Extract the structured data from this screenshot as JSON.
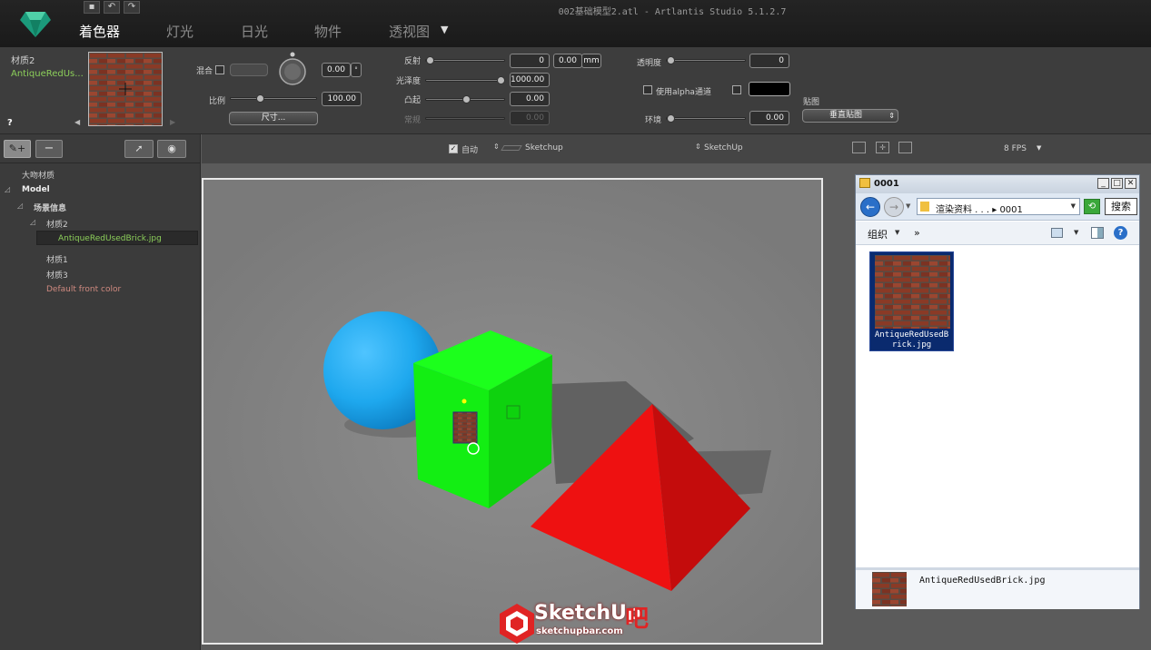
{
  "window": {
    "title": "002基础模型2.atl - Artlantis Studio 5.1.2.7",
    "tabs": [
      "着色器",
      "灯光",
      "日光",
      "物件",
      "透视图"
    ],
    "active_tab": 0
  },
  "material": {
    "name": "材质2",
    "texture_name": "AntiqueRedUs...",
    "help": "?"
  },
  "params": {
    "blend_label": "混合",
    "blend_value": "0.00",
    "scale_label": "比例",
    "scale_value": "100.00",
    "size_button": "尺寸...",
    "reflection_label": "反射",
    "reflection_value": "0",
    "reflection_dist": "0.00",
    "unit": "mm",
    "gloss_label": "光泽度",
    "gloss_value": "1000.00",
    "bump_label": "凸起",
    "bump_value": "0.00",
    "normal_label": "常规",
    "normal_value": "0.00",
    "transparency_label": "透明度",
    "transparency_value": "0",
    "alpha_label": "使用alpha通道",
    "ambient_label": "环境",
    "ambient_value": "0.00",
    "mapping_label": "贴图",
    "mapping_value": "垂直贴图"
  },
  "tree": {
    "items": [
      "大吻材质",
      "Model",
      "场景信息",
      "材质2",
      "AntiqueRedUsedBrick.jpg",
      "材质1",
      "材质3",
      "Default front color"
    ]
  },
  "toolbar": {
    "auto_label": "自动",
    "sketchup_left": "Sketchup",
    "sketchup_right": "SketchUp",
    "fps": "8 FPS"
  },
  "explorer": {
    "title": "0001",
    "path": "渲染资料 . . . ▸ 0001",
    "search": "搜索",
    "organize": "组织",
    "more": "»",
    "file_name": "AntiqueRedUsedBrick.jpg",
    "file_label_line1": "AntiqueRedUsedB",
    "file_label_line2": "rick.jpg"
  },
  "watermark": {
    "brand": "SketchUp",
    "suffix": "吧",
    "url": "sketchupbar.com"
  },
  "colors": {
    "sphere": "#1ea8ee",
    "cube": "#13ee13",
    "pyramid": "#ee1111",
    "selected_text": "#8ccf5a",
    "default_color_text": "#d08a80"
  }
}
